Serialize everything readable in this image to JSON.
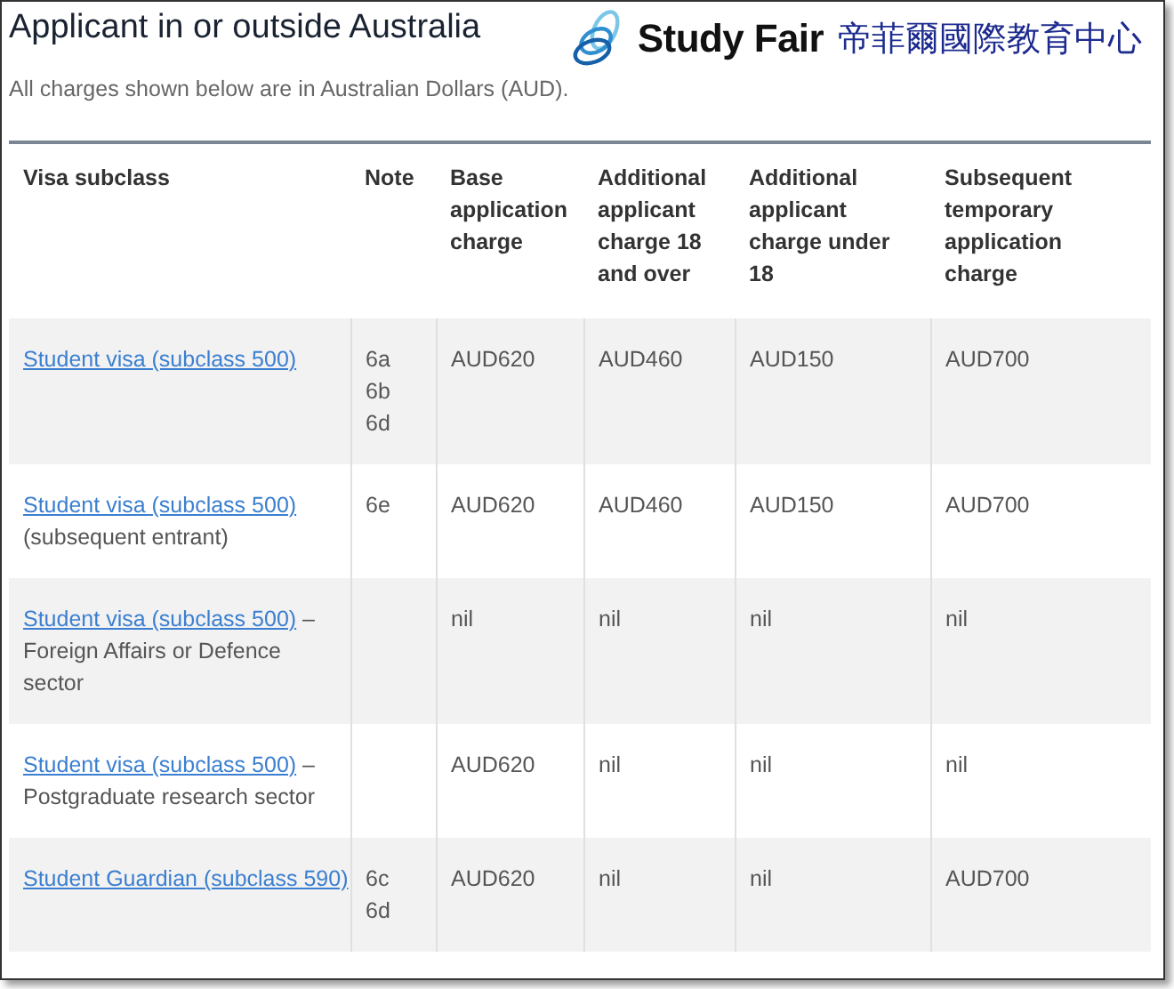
{
  "heading": "Applicant in or outside Australia",
  "logo": {
    "name": "Study Fair",
    "chinese": "帝菲爾國際教育中心"
  },
  "intro": "All charges shown below are in Australian Dollars (AUD).",
  "table": {
    "columns": [
      "Visa subclass",
      "Note",
      "Base application charge",
      "Additional applicant charge 18 and over",
      "Additional applicant charge under 18",
      "Subsequent temporary application charge"
    ],
    "rows": [
      {
        "link": "Student visa (subclass 500)",
        "rest": "",
        "notes": [
          "6a",
          "6b",
          "6d"
        ],
        "charges": [
          "AUD620",
          "AUD460",
          "AUD150",
          "AUD700"
        ]
      },
      {
        "link": "Student visa (subclass 500)",
        "rest": "(subsequent entrant)",
        "notes": [
          "6e"
        ],
        "charges": [
          "AUD620",
          "AUD460",
          "AUD150",
          "AUD700"
        ]
      },
      {
        "link": "Student visa (subclass 500)",
        "rest": "– Foreign Affairs or Defence sector",
        "notes": [],
        "charges": [
          "nil",
          "nil",
          "nil",
          "nil"
        ]
      },
      {
        "link": "Student visa (subclass 500)",
        "rest": "– Postgraduate research sector",
        "notes": [],
        "charges": [
          "AUD620",
          "nil",
          "nil",
          "nil"
        ]
      },
      {
        "link": "Student Guardian (subclass 590)",
        "rest": "",
        "notes": [
          "6c",
          "6d"
        ],
        "charges": [
          "AUD620",
          "nil",
          "nil",
          "AUD700"
        ]
      }
    ]
  }
}
